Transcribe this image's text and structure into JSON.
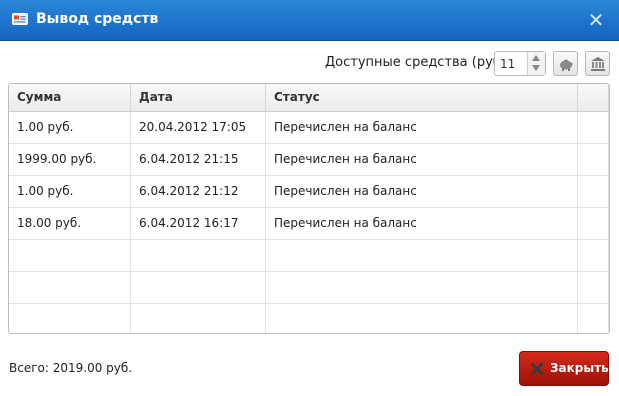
{
  "window": {
    "title": "Вывод средств"
  },
  "toolbar": {
    "funds_label": "Доступные средства (руб.):",
    "funds_value": "11"
  },
  "table": {
    "columns": [
      "Сумма",
      "Дата",
      "Статус"
    ],
    "rows": [
      [
        "1.00 руб.",
        "20.04.2012 17:05",
        "Перечислен на баланс"
      ],
      [
        "1999.00 руб.",
        "6.04.2012 21:15",
        "Перечислен на баланс"
      ],
      [
        "1.00 руб.",
        "6.04.2012 21:12",
        "Перечислен на баланс"
      ],
      [
        "18.00 руб.",
        "6.04.2012 16:17",
        "Перечислен на баланс"
      ]
    ]
  },
  "footer": {
    "total": "Всего: 2019.00 руб.",
    "close_label": "Закрыть"
  },
  "icons": [
    "window-card-icon",
    "close-icon",
    "piggy-bank-icon",
    "bank-icon",
    "close-x-icon"
  ],
  "colors": {
    "titlebar": "#1e76cc",
    "close_button": "#b81a0e"
  }
}
